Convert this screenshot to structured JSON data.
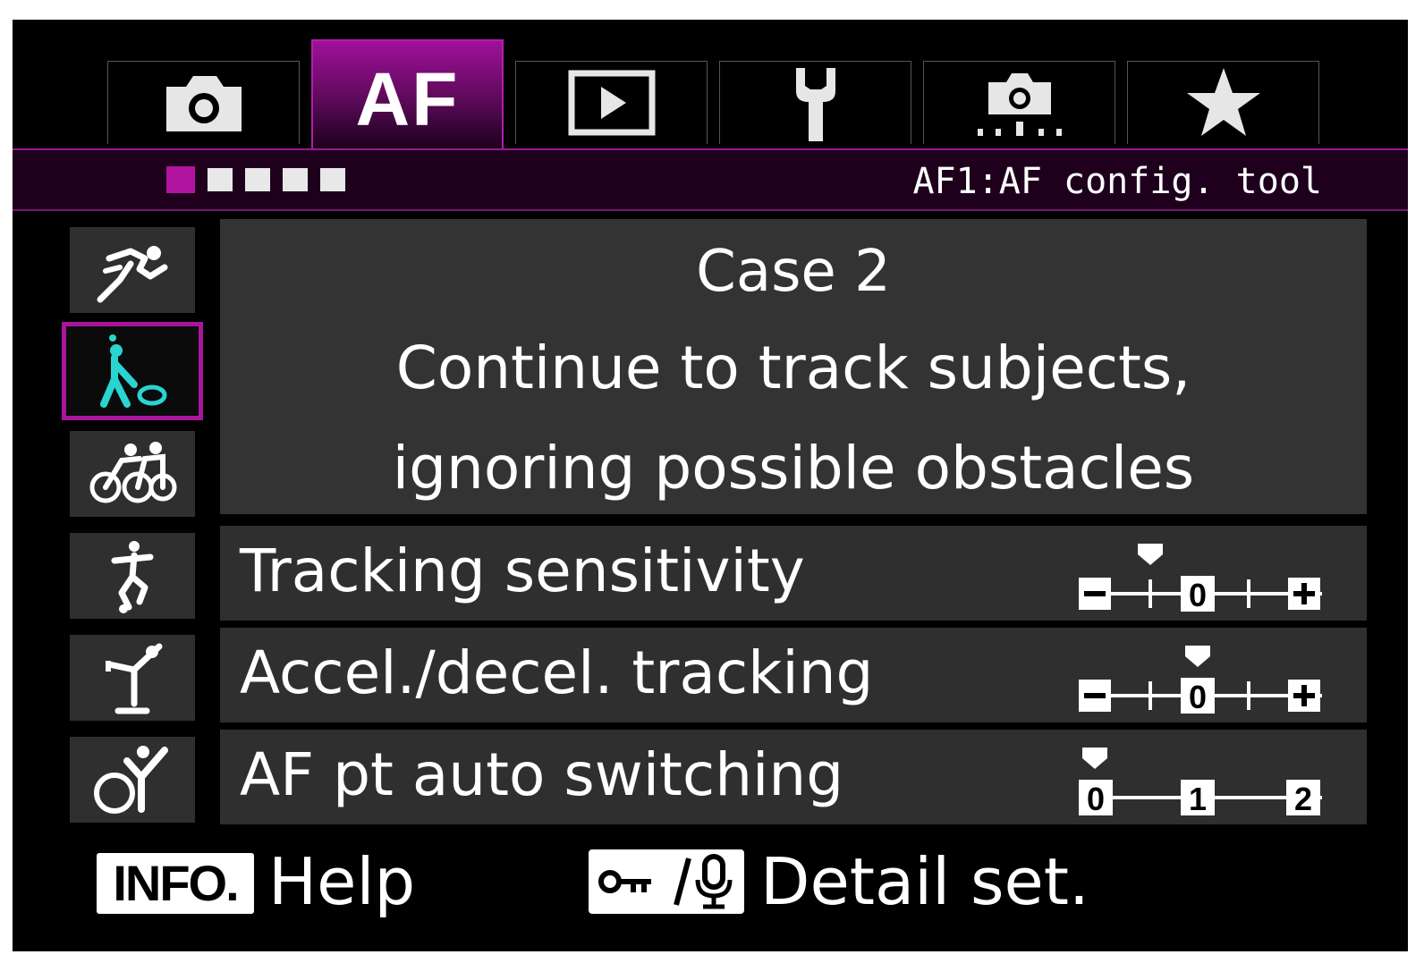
{
  "tabs": [
    {
      "name": "shooting",
      "icon": "camera-icon",
      "active": false
    },
    {
      "name": "af",
      "label": "AF",
      "active": true
    },
    {
      "name": "playback",
      "icon": "play-icon",
      "active": false
    },
    {
      "name": "setup",
      "icon": "wrench-icon",
      "active": false
    },
    {
      "name": "custom",
      "icon": "custom-functions-icon",
      "active": false
    },
    {
      "name": "my-menu",
      "icon": "star-icon",
      "active": false
    }
  ],
  "page_indicator": {
    "total": 5,
    "current": 1
  },
  "subtitle": "AF1:AF config. tool",
  "cases": [
    {
      "id": 1,
      "icon": "runner-icon",
      "selected": false
    },
    {
      "id": 2,
      "icon": "tennis-player-icon",
      "selected": true
    },
    {
      "id": 3,
      "icon": "cyclists-icon",
      "selected": false
    },
    {
      "id": 4,
      "icon": "soccer-player-icon",
      "selected": false
    },
    {
      "id": 5,
      "icon": "skater-icon",
      "selected": false
    },
    {
      "id": 6,
      "icon": "bmx-rider-icon",
      "selected": false
    }
  ],
  "description": {
    "case_title": "Case 2",
    "line1": "Continue to track subjects,",
    "line2": "ignoring possible obstacles"
  },
  "settings": [
    {
      "label": "Tracking sensitivity",
      "scale": "minus-plus",
      "value": -1
    },
    {
      "label": "Accel./decel. tracking",
      "scale": "minus-plus",
      "value": 0
    },
    {
      "label": "AF pt auto switching",
      "scale": "zero-two",
      "value": 0
    }
  ],
  "scale_labels": {
    "zero": "0",
    "one": "1",
    "two": "2"
  },
  "footer": {
    "info_label": "INFO.",
    "help_label": "Help",
    "key_icon": "protect-voice-memo-icon",
    "key_label": "Detail set."
  },
  "colors": {
    "accent": "#a8169c",
    "panel": "#333333",
    "background": "#000000"
  }
}
